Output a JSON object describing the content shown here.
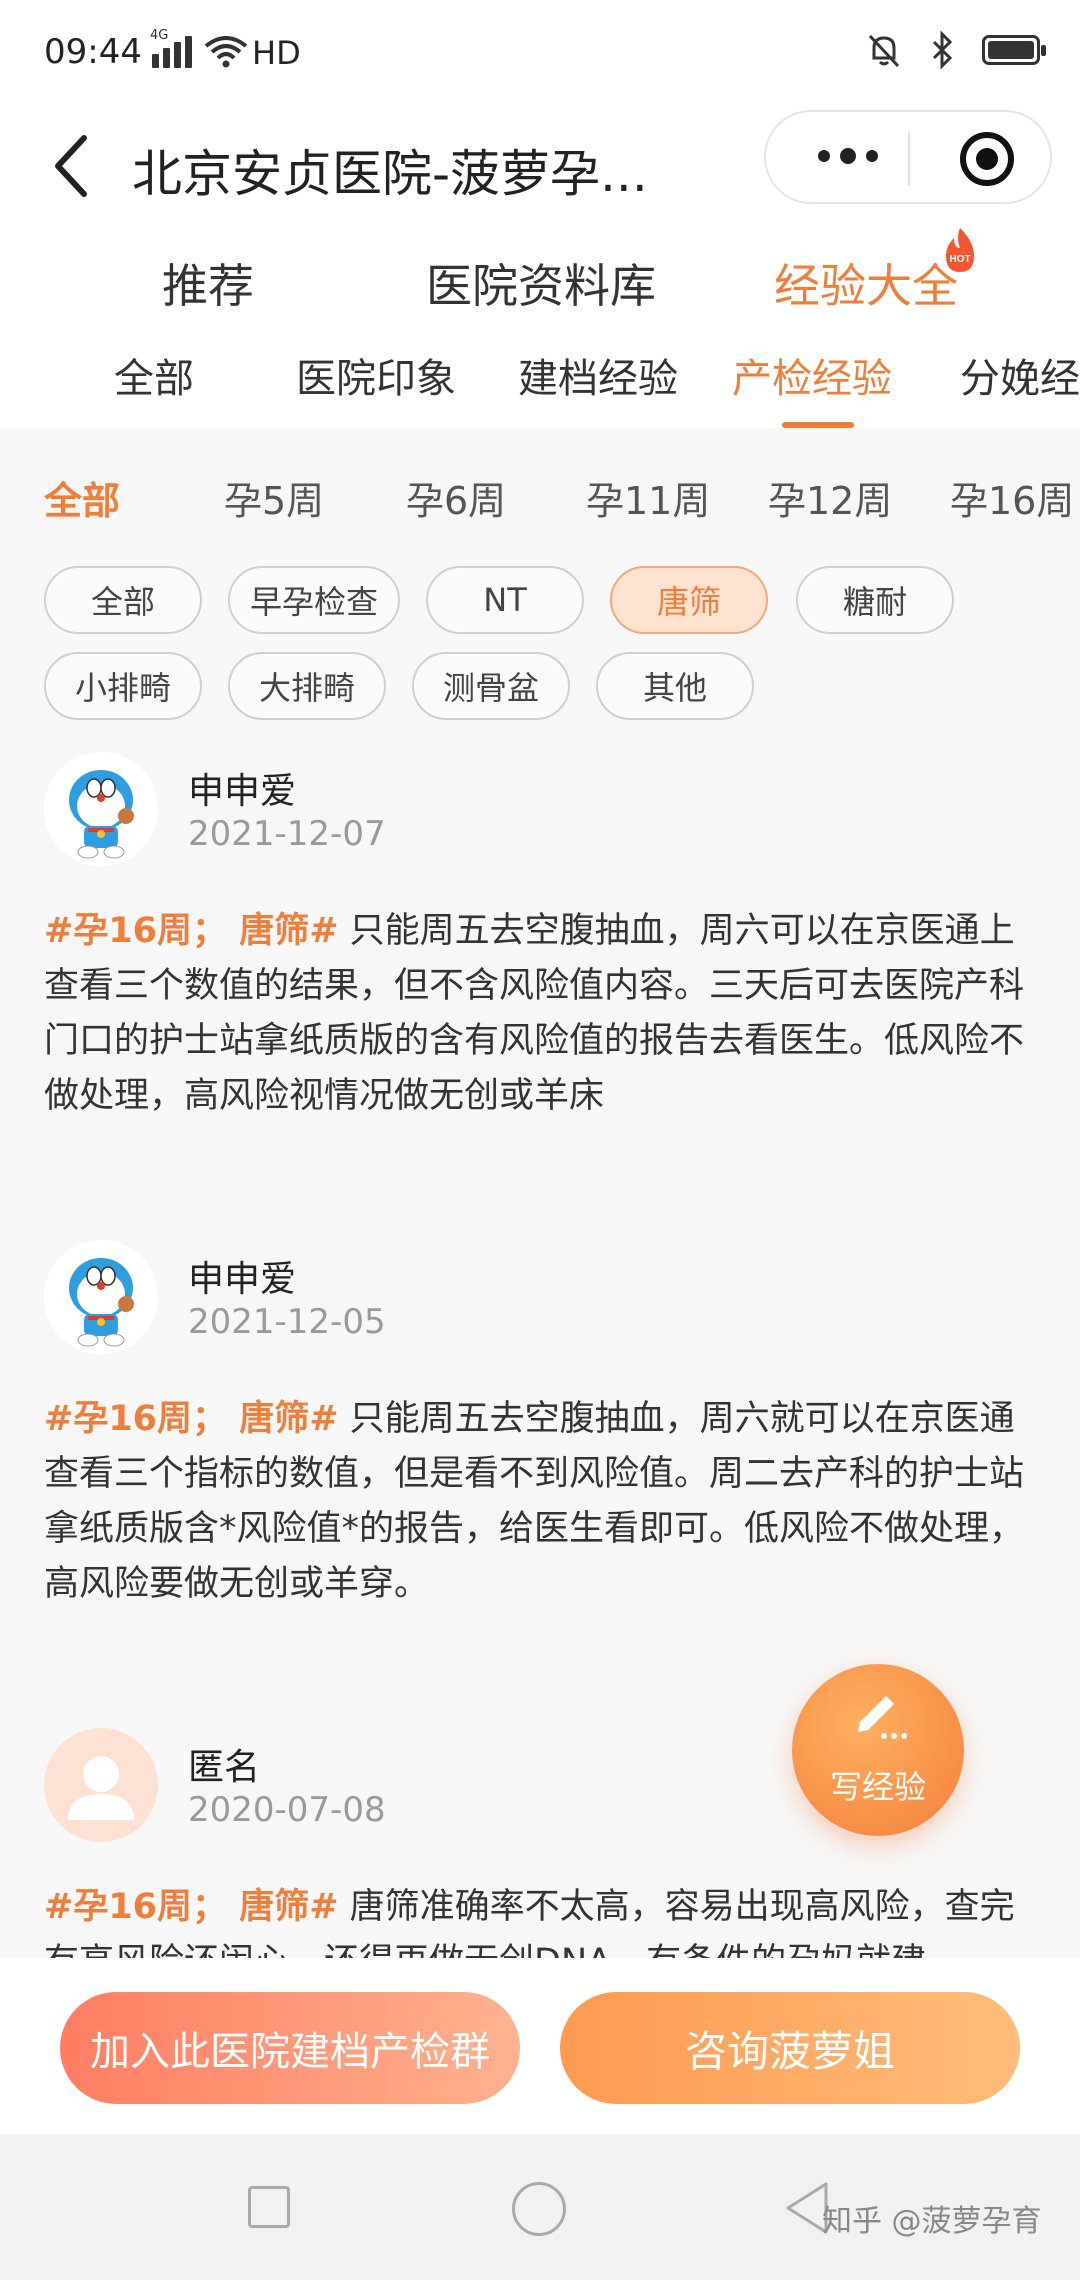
{
  "status_bar": {
    "time": "09:44",
    "network": "4G",
    "hd": "HD"
  },
  "header": {
    "title": "北京安贞医院-菠萝孕..."
  },
  "main_tabs": [
    {
      "label": "推荐"
    },
    {
      "label": "医院资料库"
    },
    {
      "label": "经验大全",
      "badge": "HOT",
      "active": true
    }
  ],
  "sub_tabs": [
    {
      "label": "全部"
    },
    {
      "label": "医院印象"
    },
    {
      "label": "建档经验"
    },
    {
      "label": "产检经验",
      "active": true
    },
    {
      "label": "分娩经"
    }
  ],
  "weeks": [
    {
      "label": "全部",
      "active": true
    },
    {
      "label": "孕5周"
    },
    {
      "label": "孕6周"
    },
    {
      "label": "孕11周"
    },
    {
      "label": "孕12周"
    },
    {
      "label": "孕16周"
    }
  ],
  "chips": [
    {
      "label": "全部"
    },
    {
      "label": "早孕检查"
    },
    {
      "label": "NT"
    },
    {
      "label": "唐筛",
      "active": true
    },
    {
      "label": "糖耐"
    },
    {
      "label": "小排畸"
    },
    {
      "label": "大排畸"
    },
    {
      "label": "测骨盆"
    },
    {
      "label": "其他"
    }
  ],
  "posts": [
    {
      "name": "申申爱",
      "date": "2021-12-07",
      "tags": "#孕16周； 唐筛#",
      "text": " 只能周五去空腹抽血，周六可以在京医通上查看三个数值的结果，但不含风险值内容。三天后可去医院产科门口的护士站拿纸质版的含有风险值的报告去看医生。低风险不做处理，高风险视情况做无创或羊床"
    },
    {
      "name": "申申爱",
      "date": "2021-12-05",
      "tags": "#孕16周； 唐筛#",
      "text": " 只能周五去空腹抽血，周六就可以在京医通查看三个指标的数值，但是看不到风险值。周二去产科的护士站拿纸质版含*风险值*的报告，给医生看即可。低风险不做处理，高风险要做无创或羊穿。"
    },
    {
      "name": "匿名",
      "date": "2020-07-08",
      "tags": "#孕16周； 唐筛#",
      "text": " 唐筛准确率不太高，容易出现高风险，查完有高风险还闹心，还得再做无创DNA，有条件的孕妈就建"
    }
  ],
  "fab": {
    "label": "写经验"
  },
  "actions": {
    "join": "加入此医院建档产检群",
    "ask": "咨询菠萝姐"
  },
  "watermark": "知乎 @菠萝孕育",
  "colors": {
    "accent": "#f07e3b"
  }
}
